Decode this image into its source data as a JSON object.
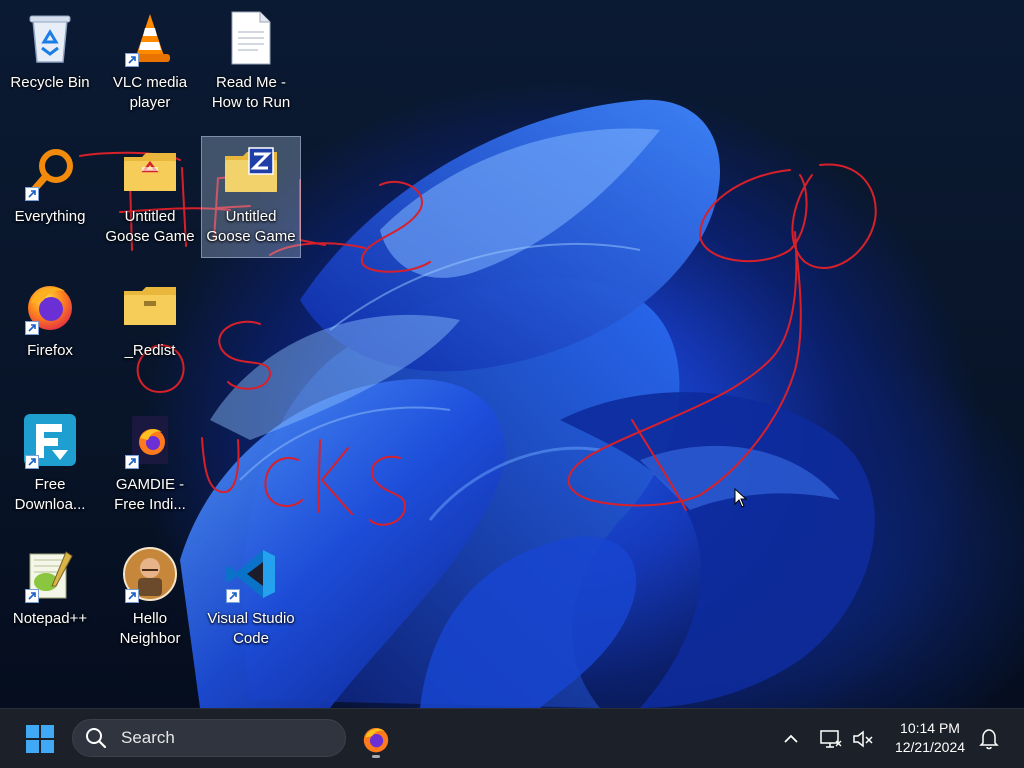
{
  "desktop": {
    "icons": [
      {
        "label": "Recycle Bin"
      },
      {
        "label": "VLC media player"
      },
      {
        "label": "Read Me - How to Run"
      },
      {
        "label": "Everything"
      },
      {
        "label": "Untitled Goose Game"
      },
      {
        "label": "Untitled Goose Game"
      },
      {
        "label": "Firefox"
      },
      {
        "label": "_Redist"
      },
      {
        "label": "Free Downloa..."
      },
      {
        "label": "GAMDIE - Free Indi..."
      },
      {
        "label": "Notepad++"
      },
      {
        "label": "Hello Neighbor"
      },
      {
        "label": "Visual Studio Code"
      }
    ],
    "annotation_color": "#d8202a"
  },
  "taskbar": {
    "search_placeholder": "Search",
    "pinned": [
      {
        "icon": "firefox-icon",
        "running": true
      }
    ],
    "tray": {
      "overflow_icon": "chevron-up-icon",
      "network_icon": "network-icon",
      "volume_icon": "volume-muted-icon",
      "notification_icon": "bell-icon"
    },
    "clock": {
      "time": "10:14 PM",
      "date": "12/21/2024"
    }
  }
}
